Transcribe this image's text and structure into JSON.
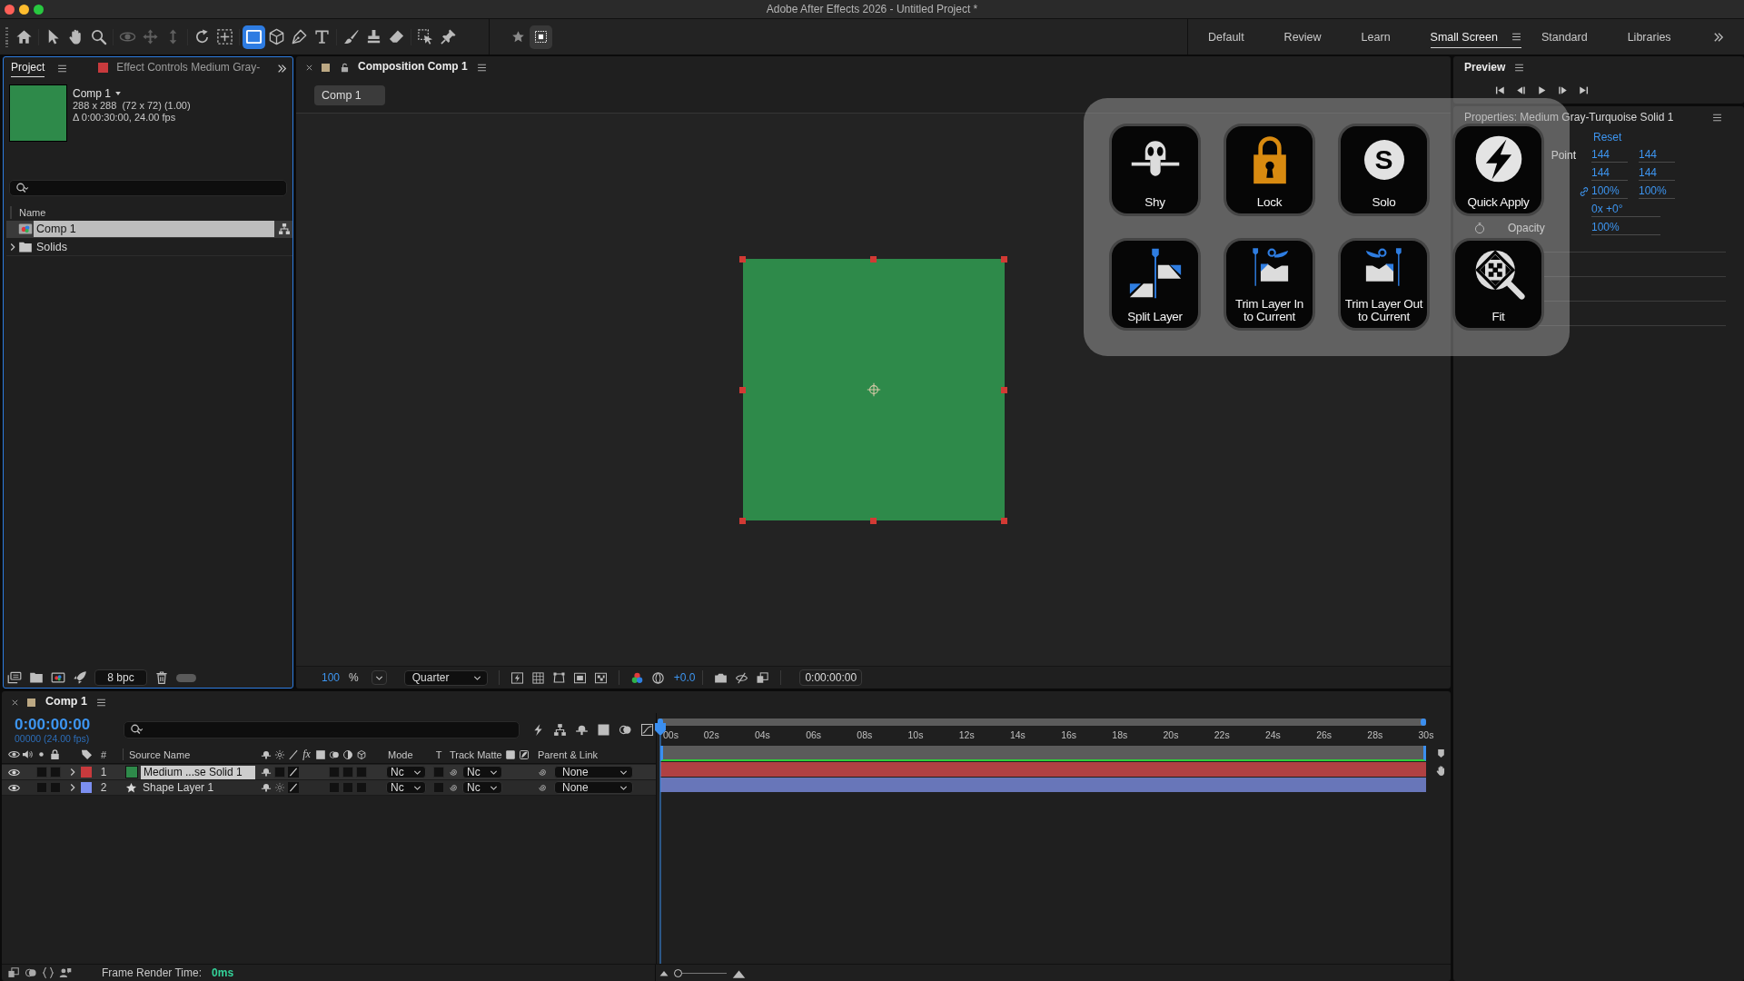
{
  "window": {
    "title": "Adobe After Effects 2026 - Untitled Project *"
  },
  "toolbar": {
    "tool_groups": [
      [
        {
          "kind": "home",
          "selected": false,
          "disabled": false
        }
      ],
      [
        {
          "kind": "selection",
          "selected": false,
          "disabled": false
        },
        {
          "kind": "hand",
          "selected": false,
          "disabled": false
        },
        {
          "kind": "zoom",
          "selected": false,
          "disabled": false
        }
      ],
      [
        {
          "kind": "orbit",
          "selected": false,
          "disabled": true
        },
        {
          "kind": "pan",
          "selected": false,
          "disabled": true
        },
        {
          "kind": "dolly",
          "selected": false,
          "disabled": true
        }
      ],
      [
        {
          "kind": "rotate",
          "selected": false,
          "disabled": false
        },
        {
          "kind": "anchor",
          "selected": false,
          "disabled": false
        }
      ],
      [
        {
          "kind": "rectangle",
          "selected": true,
          "disabled": false
        },
        {
          "kind": "cube",
          "selected": false,
          "disabled": false
        },
        {
          "kind": "pen",
          "selected": false,
          "disabled": false
        },
        {
          "kind": "type",
          "selected": false,
          "disabled": false
        }
      ],
      [
        {
          "kind": "brush",
          "selected": false,
          "disabled": false
        },
        {
          "kind": "stamp",
          "selected": false,
          "disabled": false
        },
        {
          "kind": "eraser",
          "selected": false,
          "disabled": false
        }
      ],
      [
        {
          "kind": "roto",
          "selected": false,
          "disabled": false
        },
        {
          "kind": "pin",
          "selected": false,
          "disabled": false
        }
      ]
    ],
    "extras": [
      {
        "kind": "star",
        "on": false
      },
      {
        "kind": "snapping",
        "on": true
      }
    ]
  },
  "workspaces": [
    {
      "label": "Default",
      "selected": false
    },
    {
      "label": "Review",
      "selected": false
    },
    {
      "label": "Learn",
      "selected": false
    },
    {
      "label": "Small Screen",
      "selected": true
    },
    {
      "label": "Standard",
      "selected": false
    },
    {
      "label": "Libraries",
      "selected": false
    }
  ],
  "project_panel": {
    "tabs": [
      {
        "kind": "project",
        "label": "Project",
        "selected": true
      },
      {
        "kind": "effect",
        "label": "Effect Controls Medium Gray-",
        "selected": false
      }
    ],
    "preview": {
      "name": "Comp 1",
      "details": [
        "288 x 288  (72 x 72) (1.00)",
        "Δ 0:00:30:00, 24.00 fps"
      ]
    },
    "columns": [
      "Name"
    ],
    "items": [
      {
        "kind": "composition",
        "name": "Comp 1",
        "selected": true
      },
      {
        "kind": "folder",
        "name": "Solids",
        "selected": false,
        "expanded": false
      }
    ],
    "bit_depth": "8 bpc",
    "footer_toggle": {
      "on": false
    }
  },
  "composition_panel": {
    "tab": "Composition Comp 1",
    "breadcrumb": "Comp 1",
    "toolbar": {
      "magnification": "100",
      "magnification_unit": "%",
      "resolution": "Quarter",
      "exposure": "+0.0",
      "timecode": "0:00:00:00"
    }
  },
  "shortcut_panel": {
    "buttons": [
      {
        "kind": "shy",
        "label": "Shy"
      },
      {
        "kind": "lock",
        "label": "Lock"
      },
      {
        "kind": "solo",
        "label": "Solo",
        "glyph": "S"
      },
      {
        "kind": "quick_apply",
        "label": "Quick Apply"
      },
      {
        "kind": "split",
        "label": "Split Layer"
      },
      {
        "kind": "trim_in",
        "label": "Trim Layer In to Current"
      },
      {
        "kind": "trim_out",
        "label": "Trim Layer Out to Current"
      },
      {
        "kind": "fit",
        "label": "Fit"
      }
    ]
  },
  "preview_panel": {
    "title": "Preview",
    "controls": [
      {
        "kind": "first"
      },
      {
        "kind": "previous"
      },
      {
        "kind": "play"
      },
      {
        "kind": "next"
      },
      {
        "kind": "last"
      }
    ]
  },
  "properties_panel": {
    "title": "Properties: Medium Gray-Turquoise Solid 1",
    "reset": "Reset",
    "rows": [
      {
        "name_tail": "Point",
        "values": [
          "144",
          "144"
        ],
        "linked": false
      },
      {
        "values": [
          "144",
          "144"
        ],
        "linked": false
      },
      {
        "values": [
          "100%",
          "100%"
        ],
        "linked": true
      },
      {
        "values": [
          "0x +0°"
        ],
        "linked": false
      },
      {
        "name": "Opacity",
        "values": [
          "100%"
        ],
        "linked": false
      }
    ]
  },
  "timeline": {
    "tab": "Comp 1",
    "timecode": "0:00:00:00",
    "frame_info": "00000 (24.00 fps)",
    "headers": {
      "number": "#",
      "source_name": "Source Name",
      "fx": "fx",
      "mode": "Mode",
      "t": "T",
      "track_matte": "Track Matte",
      "parent": "Parent & Link"
    },
    "layers": [
      {
        "number": "1",
        "name": "Medium ...se Solid 1",
        "kind": "solid",
        "color": "#c83a3d",
        "selected": true,
        "visible": true,
        "solo": false,
        "locked": false,
        "expanded": false,
        "mode": "Nc",
        "track_matte": "Nc",
        "parent": "None"
      },
      {
        "number": "2",
        "name": "Shape Layer 1",
        "kind": "shape",
        "color": "#7c8ff0",
        "selected": false,
        "visible": true,
        "solo": false,
        "locked": false,
        "expanded": false,
        "mode": "Nc",
        "track_matte": "Nc",
        "parent": "None"
      }
    ],
    "ruler": [
      "00s",
      "02s",
      "04s",
      "06s",
      "08s",
      "10s",
      "12s",
      "14s",
      "16s",
      "18s",
      "20s",
      "22s",
      "24s",
      "26s",
      "28s",
      "30s"
    ],
    "zoom_slider": {
      "level": 0
    },
    "status_bar": {
      "label": "Frame Render Time:",
      "value": "0ms"
    }
  }
}
